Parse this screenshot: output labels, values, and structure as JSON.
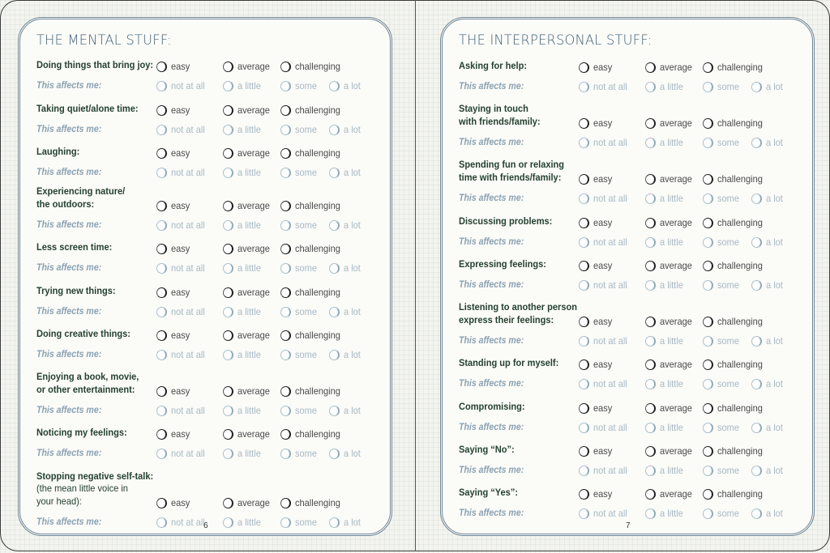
{
  "left_page": {
    "title": "THE MENTAL STUFF:",
    "page_number": "6",
    "items": [
      {
        "label": "Doing things that bring joy:"
      },
      {
        "label": "Taking quiet/alone time:"
      },
      {
        "label": "Laughing:"
      },
      {
        "label": "Experiencing nature/\nthe outdoors:"
      },
      {
        "label": "Less screen time:"
      },
      {
        "label": "Trying new things:"
      },
      {
        "label": "Doing creative things:"
      },
      {
        "label": "Enjoying a book, movie,\nor other entertainment:"
      },
      {
        "label": "Noticing my feelings:"
      },
      {
        "label": "Stopping negative self-talk:",
        "sublabel": "(the mean little voice in\nyour head):"
      }
    ]
  },
  "right_page": {
    "title": "THE INTERPERSONAL STUFF:",
    "page_number": "7",
    "items": [
      {
        "label": "Asking for help:"
      },
      {
        "label": "Staying in touch\nwith friends/family:"
      },
      {
        "label": "Spending fun or relaxing\ntime with friends/family:"
      },
      {
        "label": "Discussing problems:"
      },
      {
        "label": "Expressing feelings:"
      },
      {
        "label": "Listening to another person\nexpress their feelings:"
      },
      {
        "label": "Standing up for myself:"
      },
      {
        "label": "Compromising:"
      },
      {
        "label": "Saying “No”:"
      },
      {
        "label": "Saying “Yes”:"
      }
    ]
  },
  "difficulty_options": [
    "easy",
    "average",
    "challenging"
  ],
  "affects_label": "This affects me:",
  "affects_options": [
    "not at all",
    "a little",
    "some",
    "a lot"
  ],
  "colors": {
    "title": "#3f5f73",
    "question": "#24412f",
    "affects": "#8aa2b2",
    "frame": "#6e8697"
  }
}
